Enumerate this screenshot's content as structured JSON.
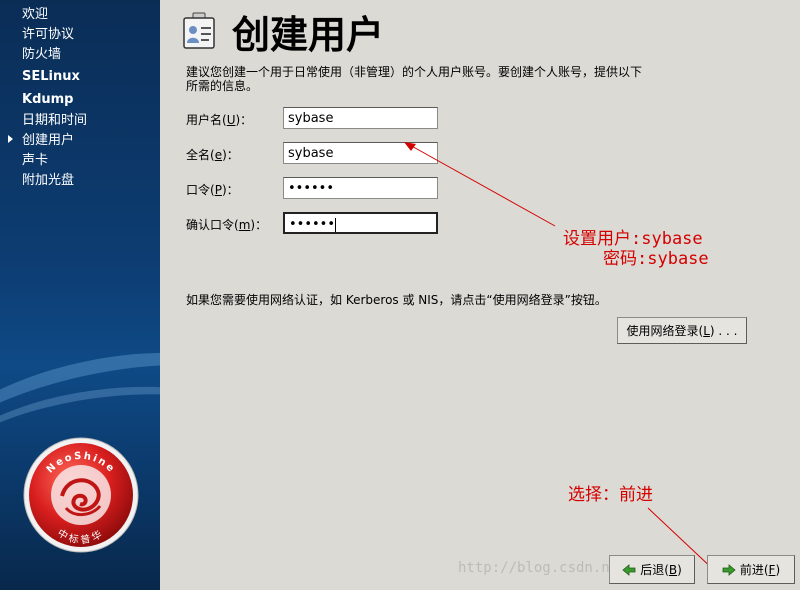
{
  "sidebar": {
    "items": [
      {
        "label": "欢迎",
        "bold": false
      },
      {
        "label": "许可协议",
        "bold": false
      },
      {
        "label": "防火墙",
        "bold": false
      },
      {
        "label": "SELinux",
        "bold": true
      },
      {
        "label": "Kdump",
        "bold": true
      },
      {
        "label": "日期和时间",
        "bold": false
      },
      {
        "label": "创建用户",
        "bold": false,
        "current": true
      },
      {
        "label": "声卡",
        "bold": false
      },
      {
        "label": "附加光盘",
        "bold": false
      }
    ],
    "logo": {
      "ring_text": "NeoShine",
      "bottom_text": "中标普华"
    }
  },
  "header": {
    "title": "创建用户",
    "icon": "user-card-icon"
  },
  "description": {
    "line1": "建议您创建一个用于日常使用（非管理）的个人用户账号。要创建个人账号，提供以下",
    "line2": "所需的信息。"
  },
  "form": {
    "username": {
      "label_pre": "用户名(",
      "mnemonic": "U",
      "label_post": ")：",
      "value": "sybase"
    },
    "fullname": {
      "label_pre": "全名(",
      "mnemonic": "e",
      "label_post": ")：",
      "value": "sybase"
    },
    "password": {
      "label_pre": "口令(",
      "mnemonic": "P",
      "label_post": ")：",
      "value": "••••••"
    },
    "confirm": {
      "label_pre": "确认口令(",
      "mnemonic": "m",
      "label_post": ")：",
      "value": "••••••"
    }
  },
  "network": {
    "text": "如果您需要使用网络认证，如 Kerberos 或 NIS，请点击“使用网络登录”按钮。",
    "button_pre": "使用网络登录(",
    "button_mnemonic": "L",
    "button_post": ") . . ."
  },
  "annotations": {
    "line1": "设置用户:sybase",
    "line2": "密码:sybase",
    "line3": "选择：前进",
    "color": "#d40000"
  },
  "watermark": "http://blog.csdn.net/",
  "footer": {
    "back": {
      "pre": "后退(",
      "mnemonic": "B",
      "post": ")"
    },
    "next": {
      "pre": "前进(",
      "mnemonic": "F",
      "post": ")"
    }
  }
}
